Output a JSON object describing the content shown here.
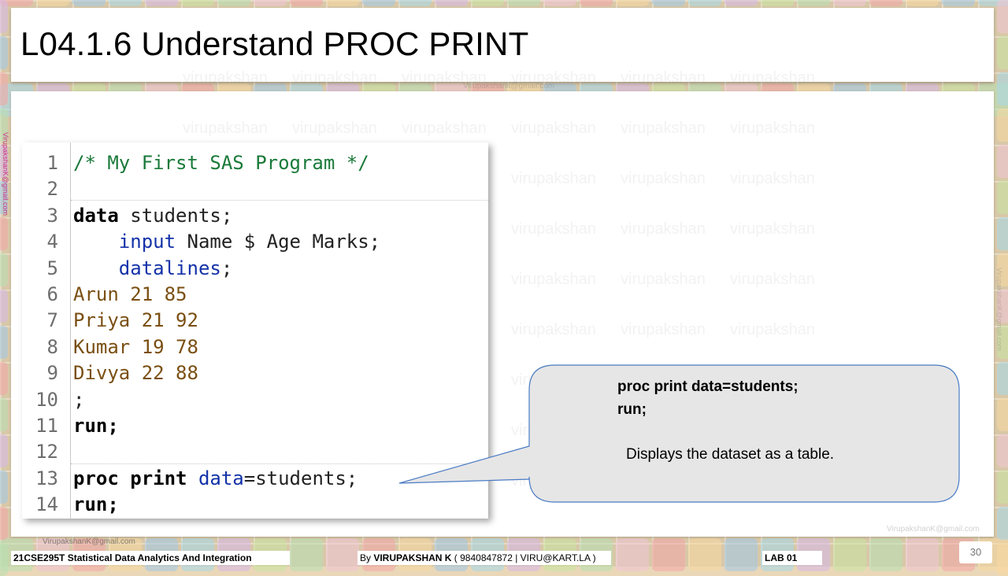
{
  "slide": {
    "title": "L04.1.6 Understand PROC PRINT",
    "page_number": "30"
  },
  "watermark": {
    "word": "virupakshan",
    "email": "VirupakshanK@gmail.com",
    "email_top": "Virupakshank@gmail.com",
    "email_side": "VirupakshanK@gmail.com"
  },
  "code": {
    "lines": [
      {
        "num": "1",
        "text": "/* My First SAS Program */"
      },
      {
        "num": "2",
        "text": ""
      },
      {
        "num": "3",
        "kw": "data",
        "rest": " students;"
      },
      {
        "num": "4",
        "kw": "    input",
        "rest": " Name $ Age Marks;"
      },
      {
        "num": "5",
        "kw": "    datalines",
        "rest": ";"
      },
      {
        "num": "6",
        "text": "Arun 21 85"
      },
      {
        "num": "7",
        "text": "Priya 21 92"
      },
      {
        "num": "8",
        "text": "Kumar 19 78"
      },
      {
        "num": "9",
        "text": "Divya 22 88"
      },
      {
        "num": "10",
        "text": ";"
      },
      {
        "num": "11",
        "text": "run;"
      },
      {
        "num": "12",
        "text": ""
      },
      {
        "num": "13",
        "kw": "proc print",
        "kw2": " data",
        "rest": "=students;"
      },
      {
        "num": "14",
        "text": "run;"
      }
    ]
  },
  "callout": {
    "code_line_1": "proc print data=students;",
    "code_line_2": "run;",
    "description": "Displays the dataset as a table."
  },
  "footer": {
    "course": "21CSE295T Statistical Data Analytics And Integration",
    "author_prefix": "By ",
    "author_name": "VIRUPAKSHAN K",
    "author_contact": " ( 9840847872 | VIRU@KART.LA )",
    "lab": "LAB  01",
    "email": "VirupakshanK@gmail.com"
  },
  "colors": {
    "comment": "#1a7a3a",
    "keyword": "#0b1f8c",
    "data_values": "#7a4f12",
    "callout_fill": "#e6e6e6",
    "callout_border": "#4a7bc4"
  }
}
